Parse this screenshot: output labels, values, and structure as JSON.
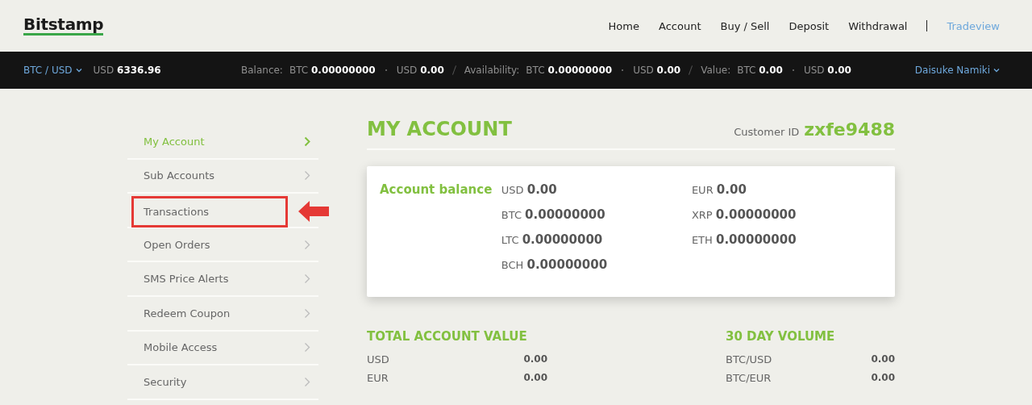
{
  "logo": "Bitstamp",
  "nav": [
    {
      "label": "Home",
      "kind": "link"
    },
    {
      "label": "Account",
      "kind": "link"
    },
    {
      "label": "Buy / Sell",
      "kind": "link"
    },
    {
      "label": "Deposit",
      "kind": "link"
    },
    {
      "label": "Withdrawal",
      "kind": "link"
    },
    {
      "label": "Tradeview",
      "kind": "accent"
    }
  ],
  "ticker": {
    "pair": "BTC / USD",
    "price_currency": "USD",
    "price": "6336.96",
    "groups": [
      {
        "label": "Balance:",
        "items": [
          {
            "currency": "BTC",
            "amount": "0.00000000"
          },
          {
            "currency": "USD",
            "amount": "0.00"
          }
        ]
      },
      {
        "label": "Availability:",
        "items": [
          {
            "currency": "BTC",
            "amount": "0.00000000"
          },
          {
            "currency": "USD",
            "amount": "0.00"
          }
        ]
      },
      {
        "label": "Value:",
        "items": [
          {
            "currency": "BTC",
            "amount": "0.00"
          },
          {
            "currency": "USD",
            "amount": "0.00"
          }
        ]
      }
    ],
    "user": "Daisuke Namiki"
  },
  "sidebar": {
    "items": [
      {
        "label": "My Account",
        "selected": true,
        "highlighted": false
      },
      {
        "label": "Sub Accounts",
        "selected": false,
        "highlighted": false
      },
      {
        "label": "Transactions",
        "selected": false,
        "highlighted": true
      },
      {
        "label": "Open Orders",
        "selected": false,
        "highlighted": false
      },
      {
        "label": "SMS Price Alerts",
        "selected": false,
        "highlighted": false
      },
      {
        "label": "Redeem Coupon",
        "selected": false,
        "highlighted": false
      },
      {
        "label": "Mobile Access",
        "selected": false,
        "highlighted": false
      },
      {
        "label": "Security",
        "selected": false,
        "highlighted": false
      }
    ]
  },
  "main": {
    "title": "MY ACCOUNT",
    "customer_id_label": "Customer ID",
    "customer_id": "zxfe9488",
    "balance": {
      "title": "Account balance",
      "columns": [
        [
          {
            "currency": "USD",
            "amount": "0.00"
          },
          {
            "currency": "BTC",
            "amount": "0.00000000"
          },
          {
            "currency": "LTC",
            "amount": "0.00000000"
          },
          {
            "currency": "BCH",
            "amount": "0.00000000"
          }
        ],
        [
          {
            "currency": "EUR",
            "amount": "0.00"
          },
          {
            "currency": "XRP",
            "amount": "0.00000000"
          },
          {
            "currency": "ETH",
            "amount": "0.00000000"
          }
        ]
      ]
    },
    "summaries": [
      {
        "title": "TOTAL ACCOUNT VALUE",
        "rows": [
          {
            "label": "USD",
            "value": "0.00"
          },
          {
            "label": "EUR",
            "value": "0.00"
          }
        ]
      },
      {
        "title": "30 DAY VOLUME",
        "rows": [
          {
            "label": "BTC/USD",
            "value": "0.00"
          },
          {
            "label": "BTC/EUR",
            "value": "0.00"
          }
        ]
      }
    ]
  }
}
